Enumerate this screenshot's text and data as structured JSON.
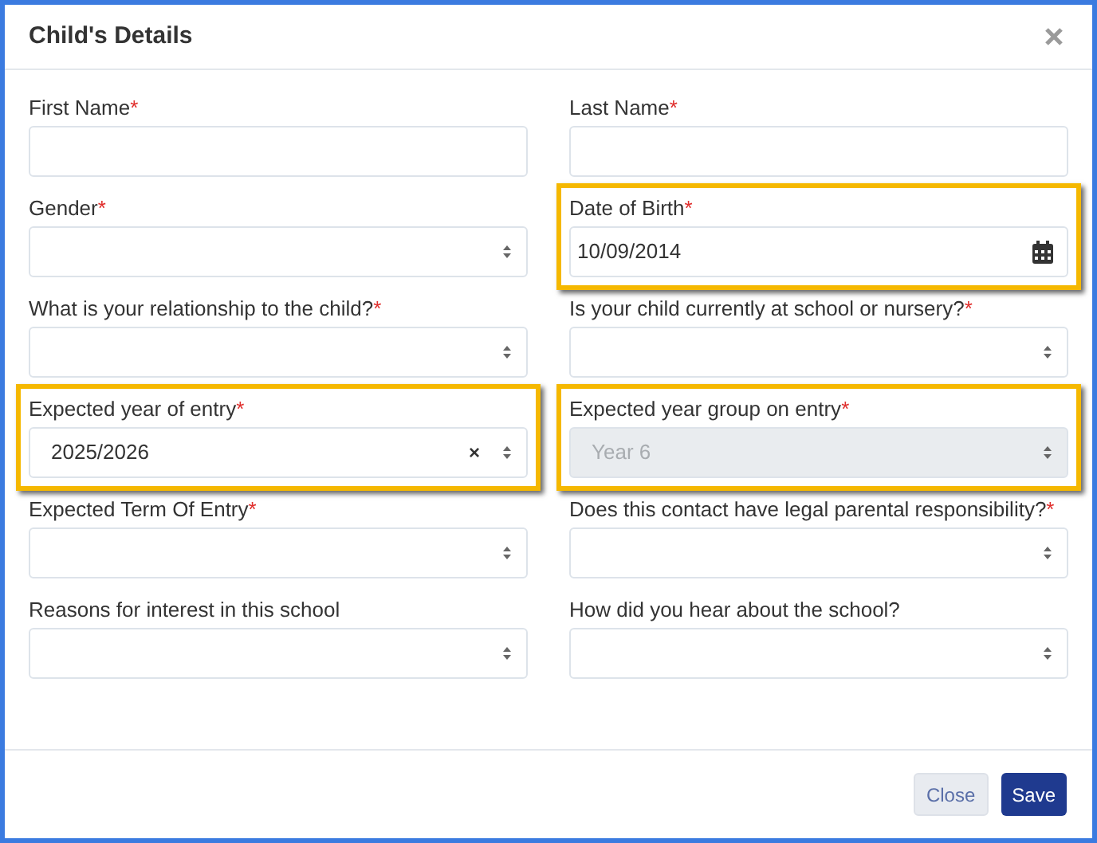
{
  "dialog": {
    "title": "Child's Details"
  },
  "fields": [
    {
      "kind": "text",
      "label": "First Name",
      "mark": "*",
      "highlighted": false,
      "disabled": false
    },
    {
      "kind": "text",
      "label": "Last Name",
      "mark": "*",
      "highlighted": false,
      "disabled": false
    },
    {
      "kind": "select",
      "label": "Gender",
      "mark": "*",
      "highlighted": false,
      "disabled": false
    },
    {
      "kind": "date",
      "label": "Date of Birth",
      "mark": "*",
      "value": "10/09/2014",
      "highlighted": true,
      "disabled": false
    },
    {
      "kind": "select",
      "label": "What is your relationship to the child?",
      "mark": "*",
      "highlighted": false,
      "disabled": false
    },
    {
      "kind": "select",
      "label": "Is your child currently at school or nursery?",
      "mark": "*",
      "highlighted": false,
      "disabled": false
    },
    {
      "kind": "select",
      "label": "Expected year of entry",
      "mark": "*",
      "value": "2025/2026",
      "clear_symbol": "×",
      "highlighted": true,
      "disabled": false
    },
    {
      "kind": "select",
      "label": "Expected year group on entry",
      "mark": "*",
      "value": "Year 6",
      "highlighted": true,
      "disabled": true
    },
    {
      "kind": "select",
      "label": "Expected Term Of Entry",
      "mark": "*",
      "highlighted": false,
      "disabled": false
    },
    {
      "kind": "select",
      "label": "Does this contact have legal parental responsibility?",
      "mark": "*",
      "highlighted": false,
      "disabled": false
    },
    {
      "kind": "select",
      "label": "Reasons for interest in this school",
      "highlighted": false,
      "disabled": false
    },
    {
      "kind": "select",
      "label": "How did you hear about the school?",
      "highlighted": false,
      "disabled": false
    }
  ],
  "buttons": [
    {
      "kind": "secondary",
      "label": "Close"
    },
    {
      "kind": "primary",
      "label": "Save"
    }
  ]
}
